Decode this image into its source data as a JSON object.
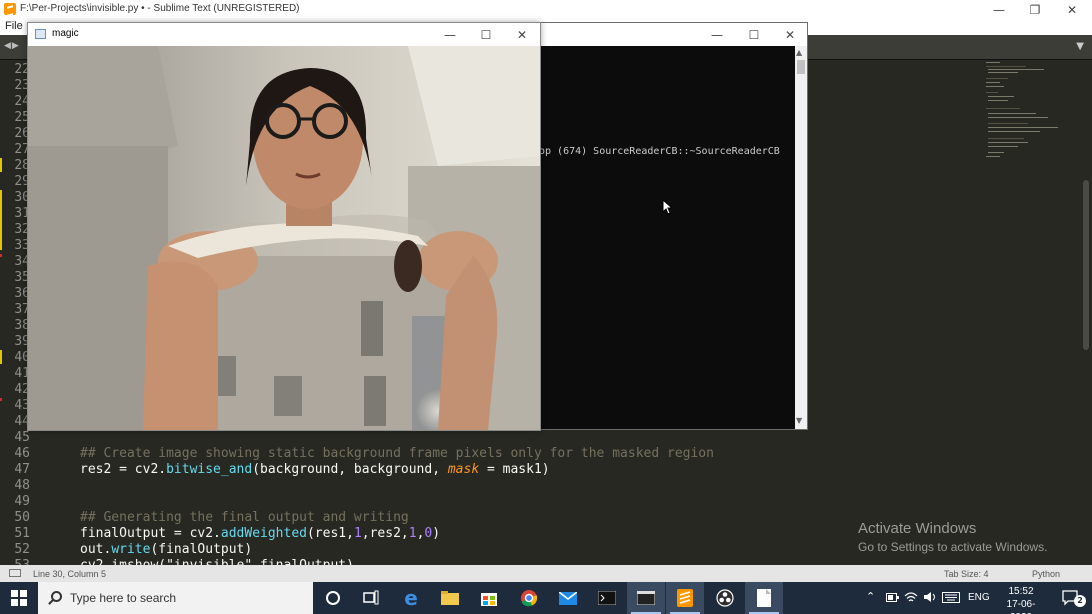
{
  "sublime": {
    "title": "F:\\Per-Projects\\invisible.py • - Sublime Text (UNREGISTERED)",
    "menu_file": "File",
    "gutter": [
      "22",
      "23",
      "24",
      "25",
      "26",
      "27",
      "28",
      "29",
      "30",
      "31",
      "32",
      "33",
      "34",
      "35",
      "36",
      "37",
      "38",
      "39",
      "40",
      "41",
      "42",
      "43",
      "44",
      "45",
      "46",
      "47",
      "48",
      "49",
      "50",
      "51",
      "52",
      "53"
    ],
    "code": {
      "l46": "## Create image showing static background frame pixels only for the masked region",
      "l47_a": "res2 = cv2.",
      "l47_func": "bitwise_and",
      "l47_b": "(background, background, ",
      "l47_kw": "mask",
      "l47_c": " = mask1)",
      "l50": "## Generating the final output and writing",
      "l51_a": "finalOutput = cv2.",
      "l51_func": "addWeighted",
      "l51_b": "(res1,",
      "l51_n1": "1",
      "l51_c": ",res2,",
      "l51_n2": "1",
      "l51_d": ",",
      "l51_n3": "0",
      "l51_e": ")",
      "l52_a": "out.",
      "l52_func": "write",
      "l52_b": "(finalOutput)",
      "l53": "cv2.imshow(\"invisible\",finalOutput)"
    },
    "status_position": "Line 30, Column 5",
    "status_tab": "Tab Size: 4",
    "status_syntax": "Python",
    "colors": {
      "bg": "#272822",
      "comment": "#75715e",
      "func": "#66d9ef",
      "keyword": "#fd971f",
      "number": "#ae81ff"
    }
  },
  "watermark": {
    "line1": "Activate Windows",
    "line2": "Go to Settings to activate Windows."
  },
  "console": {
    "text": "op (674) SourceReaderCB::~SourceReaderCB"
  },
  "magic": {
    "title": "magic"
  },
  "taskbar": {
    "search_placeholder": "Type here to search",
    "language": "ENG",
    "time": "15:52",
    "date": "17-06-2020",
    "notifications": "2"
  }
}
